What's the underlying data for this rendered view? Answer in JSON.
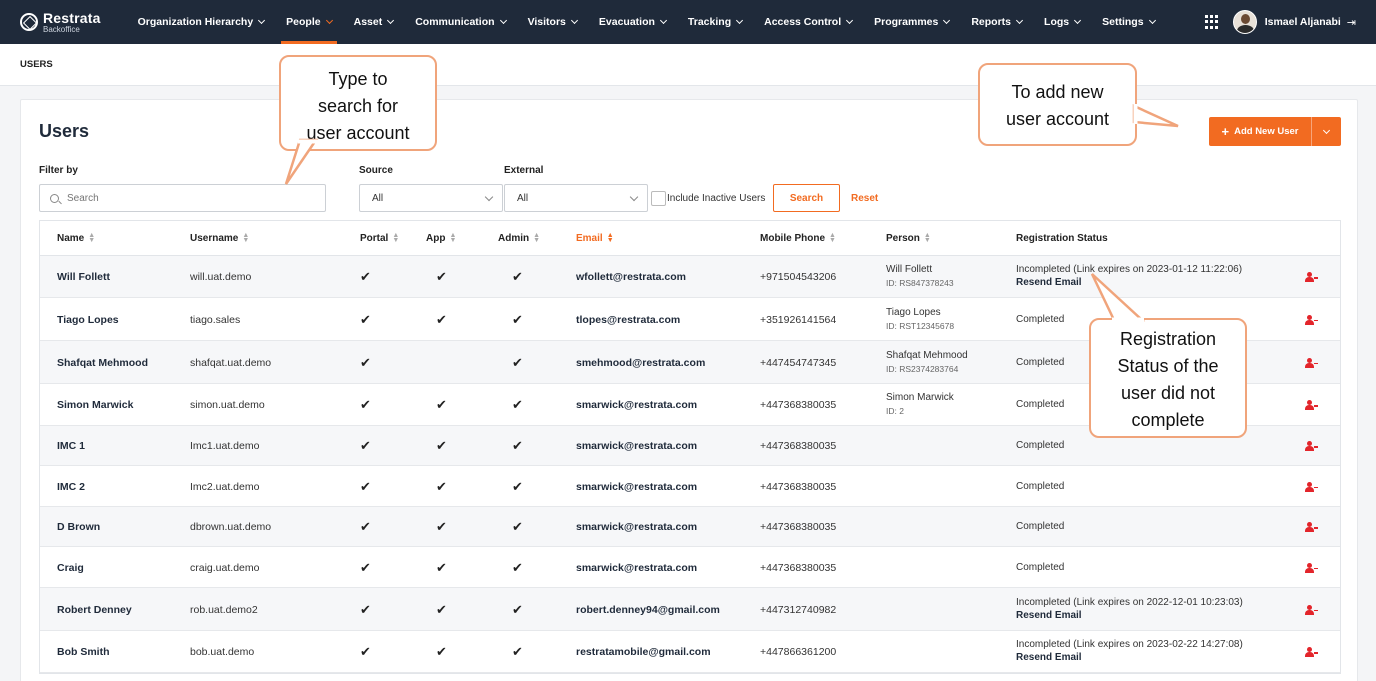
{
  "brand": {
    "title": "Restrata",
    "subtitle": "Backoffice"
  },
  "nav": [
    {
      "label": "Organization Hierarchy",
      "active": false
    },
    {
      "label": "People",
      "active": true
    },
    {
      "label": "Asset",
      "active": false
    },
    {
      "label": "Communication",
      "active": false
    },
    {
      "label": "Visitors",
      "active": false
    },
    {
      "label": "Evacuation",
      "active": false
    },
    {
      "label": "Tracking",
      "active": false
    },
    {
      "label": "Access Control",
      "active": false
    },
    {
      "label": "Programmes",
      "active": false
    },
    {
      "label": "Reports",
      "active": false
    },
    {
      "label": "Logs",
      "active": false
    },
    {
      "label": "Settings",
      "active": false
    }
  ],
  "user": {
    "name": "Ismael Aljanabi"
  },
  "breadcrumb": "USERS",
  "page": {
    "title": "Users",
    "add_button": "Add New User",
    "filter_label": "Filter by",
    "search_placeholder": "Search",
    "source_label": "Source",
    "source_value": "All",
    "external_label": "External",
    "external_value": "All",
    "include_inactive_label": "Include Inactive Users",
    "search_button": "Search",
    "reset_link": "Reset"
  },
  "table": {
    "headers": {
      "name": "Name",
      "username": "Username",
      "portal": "Portal",
      "app": "App",
      "admin": "Admin",
      "email": "Email",
      "mobile": "Mobile Phone",
      "person": "Person",
      "registration": "Registration Status"
    },
    "rows": [
      {
        "name": "Will Follett",
        "username": "will.uat.demo",
        "portal": true,
        "app": true,
        "admin": true,
        "email": "wfollett@restrata.com",
        "mobile": "+971504543206",
        "person_name": "Will Follett",
        "person_id": "ID: RS847378243",
        "status": "Incompleted (Link expires on 2023-01-12 11:22:06)",
        "resend": "Resend Email"
      },
      {
        "name": "Tiago Lopes",
        "username": "tiago.sales",
        "portal": true,
        "app": true,
        "admin": true,
        "email": "tlopes@restrata.com",
        "mobile": "+351926141564",
        "person_name": "Tiago Lopes",
        "person_id": "ID: RST12345678",
        "status": "Completed",
        "resend": ""
      },
      {
        "name": "Shafqat Mehmood",
        "username": "shafqat.uat.demo",
        "portal": true,
        "app": false,
        "admin": true,
        "email": "smehmood@restrata.com",
        "mobile": "+447454747345",
        "person_name": "Shafqat Mehmood",
        "person_id": "ID: RS2374283764",
        "status": "Completed",
        "resend": ""
      },
      {
        "name": "Simon Marwick",
        "username": "simon.uat.demo",
        "portal": true,
        "app": true,
        "admin": true,
        "email": "smarwick@restrata.com",
        "mobile": "+447368380035",
        "person_name": "Simon Marwick",
        "person_id": "ID: 2",
        "status": "Completed",
        "resend": ""
      },
      {
        "name": "IMC 1",
        "username": "Imc1.uat.demo",
        "portal": true,
        "app": true,
        "admin": true,
        "email": "smarwick@restrata.com",
        "mobile": "+447368380035",
        "person_name": "",
        "person_id": "",
        "status": "Completed",
        "resend": ""
      },
      {
        "name": "IMC 2",
        "username": "Imc2.uat.demo",
        "portal": true,
        "app": true,
        "admin": true,
        "email": "smarwick@restrata.com",
        "mobile": "+447368380035",
        "person_name": "",
        "person_id": "",
        "status": "Completed",
        "resend": ""
      },
      {
        "name": "D Brown",
        "username": "dbrown.uat.demo",
        "portal": true,
        "app": true,
        "admin": true,
        "email": "smarwick@restrata.com",
        "mobile": "+447368380035",
        "person_name": "",
        "person_id": "",
        "status": "Completed",
        "resend": ""
      },
      {
        "name": "Craig",
        "username": "craig.uat.demo",
        "portal": true,
        "app": true,
        "admin": true,
        "email": "smarwick@restrata.com",
        "mobile": "+447368380035",
        "person_name": "",
        "person_id": "",
        "status": "Completed",
        "resend": ""
      },
      {
        "name": "Robert Denney",
        "username": "rob.uat.demo2",
        "portal": true,
        "app": true,
        "admin": true,
        "email": "robert.denney94@gmail.com",
        "mobile": "+447312740982",
        "person_name": "",
        "person_id": "",
        "status": "Incompleted (Link expires on 2022-12-01 10:23:03)",
        "resend": "Resend Email"
      },
      {
        "name": "Bob Smith",
        "username": "bob.uat.demo",
        "portal": true,
        "app": true,
        "admin": true,
        "email": "restratamobile@gmail.com",
        "mobile": "+447866361200",
        "person_name": "",
        "person_id": "",
        "status": "Incompleted (Link expires on 2023-02-22 14:27:08)",
        "resend": "Resend Email"
      }
    ]
  },
  "callouts": {
    "search": [
      "Type to",
      "search for",
      "user account"
    ],
    "add": [
      "To add new",
      "user account"
    ],
    "status": [
      "Registration",
      "Status of the",
      "user did not",
      "complete"
    ]
  },
  "colors": {
    "accent": "#f26b21",
    "nav_bg": "#1f2a3a",
    "callout_border": "#f0a47b",
    "remove_icon": "#e3252b"
  }
}
